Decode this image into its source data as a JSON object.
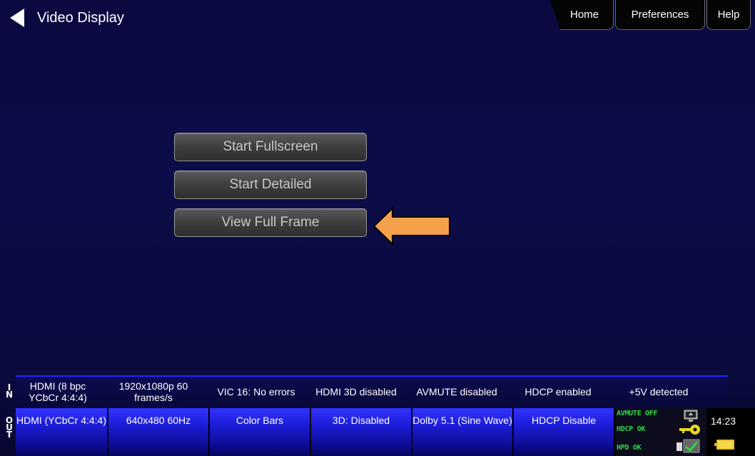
{
  "header": {
    "title": "Video Display",
    "tabs": [
      "Home",
      "Preferences",
      "Help"
    ]
  },
  "buttons": {
    "start_fullscreen": "Start Fullscreen",
    "start_detailed": "Start Detailed",
    "view_full_frame": "View Full Frame"
  },
  "status_in": {
    "side_label": [
      "I",
      "N"
    ],
    "cells": [
      "HDMI (8 bpc YCbCr 4:4:4)",
      "1920x1080p 60 frames/s",
      "VIC 16: No errors",
      "HDMI 3D disabled",
      "AVMUTE disabled",
      "HDCP enabled",
      "+5V detected"
    ]
  },
  "status_out": {
    "side_label": [
      "O",
      "U",
      "T"
    ],
    "cells": [
      "HDMI (YCbCr 4:4:4)",
      "640x480 60Hz",
      "Color Bars",
      "3D: Disabled",
      "Dolby 5.1 (Sine Wave)",
      "HDCP Disable"
    ],
    "indicators": [
      "AVMUTE OFF",
      "HDCP OK",
      "HPD OK"
    ]
  },
  "clock": "14:23",
  "icons": {
    "back": "back-arrow-icon",
    "pointer": "orange-pointer-arrow-icon",
    "monitor": "monitor-icon",
    "key": "key-icon",
    "plug": "plug-icon",
    "battery": "battery-icon"
  },
  "colors": {
    "background": "#0a0a40",
    "accent_blue": "#2424ff",
    "status_green": "#2bd84a",
    "arrow_orange": "#f5a04a"
  }
}
